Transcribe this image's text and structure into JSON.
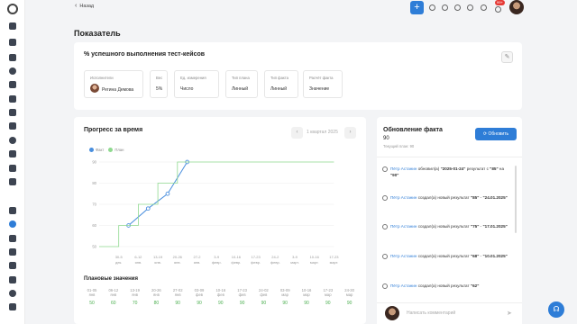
{
  "topbar": {
    "back_label": "Назад",
    "plus_label": "+",
    "notif_badge": "99+"
  },
  "page_title": "Показатель",
  "indicator": {
    "title": "% успешного выполнения тест-кейсов",
    "fields": [
      {
        "label": "Исполнители",
        "value": "Регина Демова",
        "has_avatar": true
      },
      {
        "label": "Вес",
        "value": "5%"
      },
      {
        "label": "Ед. измерения",
        "value": "Число"
      },
      {
        "label": "Тип плана",
        "value": "Линный"
      },
      {
        "label": "Тип факта",
        "value": "Линный"
      },
      {
        "label": "Расчёт факта",
        "value": "Значение"
      }
    ]
  },
  "progress": {
    "title": "Прогресс за время",
    "period": "1 квартал 2025",
    "prev": "‹",
    "next": "›",
    "legend": {
      "fact": "Факт",
      "plan": "План"
    },
    "colors": {
      "fact": "#4a8fde",
      "plan": "#8fd98f",
      "grid": "#eeeeee"
    }
  },
  "chart_data": {
    "type": "line",
    "y_ticks": [
      "90",
      "80",
      "70",
      "60",
      "50"
    ],
    "ylim": [
      50,
      90
    ],
    "categories": [
      "30-5 дек.",
      "6-12 янв.",
      "13-19 янв.",
      "20-26 янв.",
      "27-2 янв.",
      "3-9 февр.",
      "10-16 февр.",
      "17-23 февр.",
      "24-2 февр.",
      "3-9 март.",
      "10-16 март.",
      "17-23 март."
    ],
    "series": [
      {
        "name": "Факт",
        "x": [
          1.5,
          2.5,
          3.5,
          4.5
        ],
        "values": [
          60,
          68,
          75,
          90
        ]
      },
      {
        "name": "План",
        "x": [
          0,
          1,
          1,
          2,
          2,
          3,
          3,
          4,
          4,
          5,
          5,
          12
        ],
        "values": [
          50,
          50,
          60,
          60,
          70,
          70,
          80,
          80,
          90,
          90,
          90,
          90
        ]
      }
    ]
  },
  "plan": {
    "title": "Плановые значения",
    "items": [
      {
        "date": "01-05",
        "month": "янв",
        "value": "50"
      },
      {
        "date": "06-12",
        "month": "янв",
        "value": "60"
      },
      {
        "date": "13-19",
        "month": "янв",
        "value": "70"
      },
      {
        "date": "20-26",
        "month": "янв",
        "value": "80"
      },
      {
        "date": "27-02",
        "month": "янв",
        "value": "90"
      },
      {
        "date": "03-09",
        "month": "фев",
        "value": "90"
      },
      {
        "date": "10-16",
        "month": "фев",
        "value": "90"
      },
      {
        "date": "17-23",
        "month": "фев",
        "value": "90"
      },
      {
        "date": "24-02",
        "month": "фев",
        "value": "90"
      },
      {
        "date": "03-09",
        "month": "мар",
        "value": "90"
      },
      {
        "date": "10-16",
        "month": "мар",
        "value": "90"
      },
      {
        "date": "17-23",
        "month": "мар",
        "value": "90"
      },
      {
        "date": "24-30",
        "month": "мар",
        "value": "90"
      }
    ]
  },
  "fact": {
    "title": "Обновление факта",
    "value": "90",
    "sub": "Текущий план: 90",
    "refresh_label": "Обновить",
    "feed": [
      {
        "user": "Пётр Астанин",
        "action": "обновил(а)",
        "v1": "\"2025-01-24\"",
        "mid": "результат с",
        "v2": "\"85\"",
        "mid2": "на",
        "v3": "\"90\"",
        "date": ""
      },
      {
        "user": "Пётр Астанин",
        "action": "создал(а) новый результат",
        "v1": "\"85\"",
        "mid": "-",
        "v2": "\"24.01.2025\"",
        "mid2": "",
        "v3": "",
        "date": ""
      },
      {
        "user": "Пётр Астанин",
        "action": "создал(а) новый результат",
        "v1": "\"75\"",
        "mid": "-",
        "v2": "\"17.01.2025\"",
        "mid2": "",
        "v3": "",
        "date": ""
      },
      {
        "user": "Пётр Астанин",
        "action": "создал(а) новый результат",
        "v1": "\"68\"",
        "mid": "-",
        "v2": "\"10.01.2025\"",
        "mid2": "",
        "v3": "",
        "date": ""
      },
      {
        "user": "Пётр Астанин",
        "action": "создал(а) новый результат",
        "v1": "\"62\"",
        "mid": "",
        "v2": "",
        "mid2": "",
        "v3": "",
        "date": ""
      }
    ],
    "comment_placeholder": "Написать комментарий"
  },
  "icons": [
    "back-chevron-icon",
    "search-icon",
    "bell-icon",
    "gear-icon",
    "lightbulb-icon",
    "send-icon",
    "refresh-icon",
    "edit-icon",
    "headset-icon"
  ]
}
